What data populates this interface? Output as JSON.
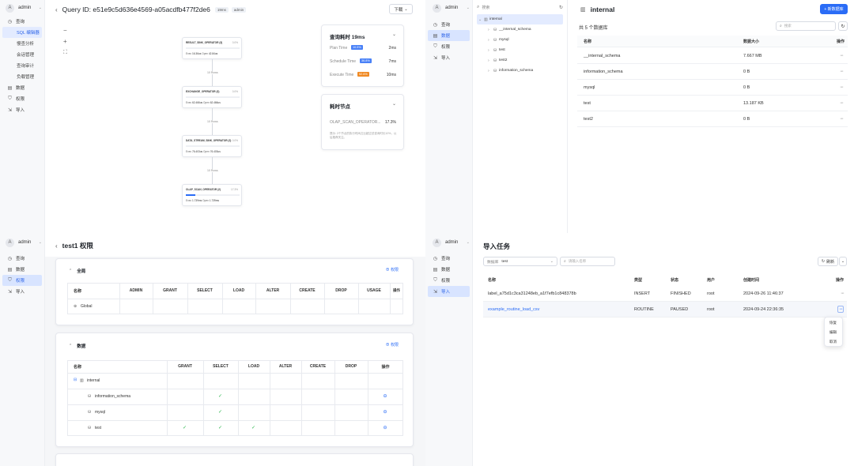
{
  "profile": {
    "query": {
      "title": "Query ID: e51e9c5d636e4569-a05acdfb477f2de6",
      "time_badge": "19ms",
      "user_badge": "admin",
      "download_label": "下载",
      "nodes": [
        {
          "name": "RESULT_SINK_OPERATOR (3)",
          "pct": "0.0%",
          "exec": "16.36us",
          "open": "42.84us",
          "progress": 0.0
        },
        {
          "name": "EXCHANGE_OPERATOR (3)",
          "pct": "0.0%",
          "exec": "62.466us",
          "open": "62.466us",
          "progress": 0.0
        },
        {
          "name": "DATA_STREAM_SINK_OPERATOR (2)",
          "pct": "0.0%",
          "exec": "76.403us",
          "open": "76.403us",
          "progress": 0.0
        },
        {
          "name": "OLAP_SCAN_OPERATOR (2)",
          "pct": "17.3%",
          "exec": "1.739ms",
          "open": "1.739ms",
          "progress": 0.173
        }
      ],
      "edges": [
        "10 Rows",
        "10 Rows",
        "10 Rows"
      ],
      "summary": {
        "title": "查询耗时 19ms",
        "rows": [
          {
            "label": "Plan Time",
            "tag": "10.5%",
            "value": "2ms",
            "color": "#2a6cf6"
          },
          {
            "label": "Schedule Time",
            "tag": "36.8%",
            "value": "7ms",
            "color": "#2a6cf6"
          },
          {
            "label": "Execute Time",
            "tag": "52.6%",
            "value": "10ms",
            "color": "#f08a24"
          }
        ]
      },
      "hot": {
        "title": "耗时节点",
        "node": "OLAP_SCAN_OPERATOR...",
        "pct": "17.3%",
        "note": "提示: 2个节点的执行时间占比超过总查询时长10%，以后推荐关注。"
      }
    },
    "sidebar": {
      "user": "admin",
      "items": [
        "查询",
        "SQL 编辑器",
        "慢查分析",
        "会话管理",
        "查询审计",
        "负载管理",
        "数据",
        "权限",
        "导入"
      ]
    }
  },
  "data_panel": {
    "sidebar": {
      "user": "admin",
      "items": [
        "查询",
        "数据",
        "权限",
        "导入"
      ]
    },
    "search_placeholder": "搜索",
    "tree": [
      "internal",
      "__internal_schema",
      "mysql",
      "test",
      "test2",
      "information_schema"
    ],
    "title": "internal",
    "new_btn": "+ 新数据库",
    "count_text": "共 5 个数据库",
    "search2": "搜索",
    "columns": [
      "名称",
      "数据大小",
      "操作"
    ],
    "rows": [
      {
        "name": "__internal_schema",
        "size": "7.667 MB"
      },
      {
        "name": "information_schema",
        "size": "0 B"
      },
      {
        "name": "mysql",
        "size": "0 B"
      },
      {
        "name": "test",
        "size": "13.187 KB"
      },
      {
        "name": "test2",
        "size": "0 B"
      }
    ]
  },
  "perm_panel": {
    "sidebar": {
      "user": "admin",
      "items": [
        "查询",
        "数据",
        "权限",
        "导入"
      ]
    },
    "title": "test1 权限",
    "global": {
      "section": "全局",
      "btn": "权限",
      "columns": [
        "名称",
        "ADMIN",
        "GRANT",
        "SELECT",
        "LOAD",
        "ALTER",
        "CREATE",
        "DROP",
        "USAGE",
        "操作"
      ],
      "row": "Global"
    },
    "data": {
      "section": "数据",
      "btn": "权限",
      "columns": [
        "名称",
        "GRANT",
        "SELECT",
        "LOAD",
        "ALTER",
        "CREATE",
        "DROP",
        "操作"
      ],
      "rows": [
        {
          "name": "internal",
          "select": false,
          "grant": false,
          "load": false,
          "action": false
        },
        {
          "name": "information_schema",
          "select": true,
          "grant": false,
          "load": false,
          "action": true
        },
        {
          "name": "mysql",
          "select": true,
          "grant": false,
          "load": false,
          "action": true
        },
        {
          "name": "test",
          "select": true,
          "grant": true,
          "load": true,
          "action": true
        }
      ]
    }
  },
  "import_panel": {
    "sidebar": {
      "user": "admin",
      "items": [
        "查询",
        "数据",
        "权限",
        "导入"
      ]
    },
    "title": "导入任务",
    "db_label": "数据库",
    "db_value": "test",
    "search_placeholder": "请输入名称",
    "refresh": "刷新",
    "columns": [
      "名称",
      "类型",
      "状态",
      "用户",
      "创建时间",
      "操作"
    ],
    "rows": [
      {
        "name": "label_a75d1c3ca31248eb_a1f7efb1c848378b",
        "type": "INSERT",
        "status": "FINISHED",
        "user": "root",
        "time": "2024-09-26 11:46:37"
      },
      {
        "name": "example_routine_load_csv",
        "type": "ROUTINE",
        "status": "PAUSED",
        "user": "root",
        "time": "2024-09-24 22:36:35"
      }
    ],
    "menu": [
      "恢复",
      "编辑",
      "取消"
    ]
  }
}
